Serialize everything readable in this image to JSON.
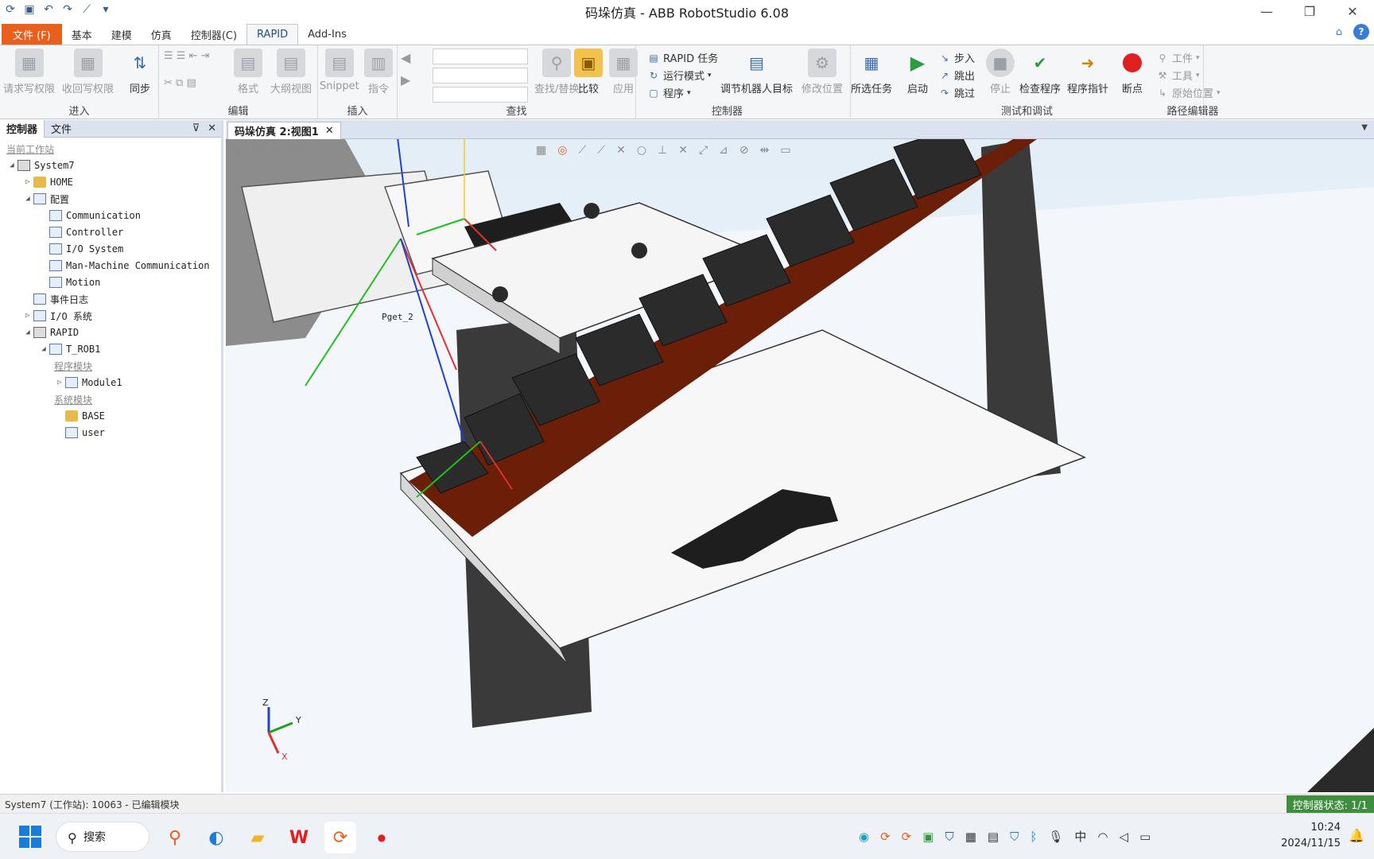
{
  "window": {
    "title": "码垛仿真 - ABB RobotStudio 6.08",
    "minimize": "—",
    "restore": "❐",
    "close": "✕"
  },
  "ribbon_tabs": [
    {
      "label": "文件 (F)"
    },
    {
      "label": "基本"
    },
    {
      "label": "建模"
    },
    {
      "label": "仿真"
    },
    {
      "label": "控制器(C)"
    },
    {
      "label": "RAPID"
    },
    {
      "label": "Add-Ins"
    }
  ],
  "ribbon": {
    "groups": {
      "enter": "进入",
      "edit": "编辑",
      "insert": "插入",
      "find": "查找",
      "controller": "控制器",
      "test": "测试和调试",
      "path_editor": "路径编辑器"
    },
    "buttons": {
      "request_write": "请求写权限",
      "release_write": "收回写权限",
      "sync": "同步",
      "format": "格式",
      "outline": "大纲视图",
      "snippet": "Snippet",
      "instruction": "指令",
      "find_replace": "查找/替换",
      "compare": "比较",
      "apply": "应用",
      "rapid_task": "RAPID 任务",
      "run_mode": "运行模式",
      "program": "程序",
      "adjust_targets": "调节机器人目标",
      "modify_position": "修改位置",
      "selected_tasks": "所选任务",
      "start": "启动",
      "step_in": "步入",
      "step_out": "跳出",
      "step_over": "跳过",
      "stop": "停止",
      "check_program": "检查程序",
      "program_pointer": "程序指针",
      "breakpoint": "断点",
      "workobject": "工件",
      "tool": "工具",
      "home_position": "原始位置"
    }
  },
  "left_panel": {
    "tabs": [
      "控制器",
      "文件"
    ],
    "pin": "⊽",
    "close": "✕",
    "tree": [
      {
        "label": "当前工作站",
        "indent": 0,
        "expander": "",
        "icon": "",
        "link": true
      },
      {
        "label": "System7",
        "indent": 0,
        "expander": "◢",
        "icon": "controller-icon"
      },
      {
        "label": "HOME",
        "indent": 1,
        "expander": "▷",
        "icon": "folder-icon"
      },
      {
        "label": "配置",
        "indent": 1,
        "expander": "◢",
        "icon": "config-icon"
      },
      {
        "label": "Communication",
        "indent": 2,
        "expander": "",
        "icon": "config-topic-icon"
      },
      {
        "label": "Controller",
        "indent": 2,
        "expander": "",
        "icon": "config-topic-icon"
      },
      {
        "label": "I/O System",
        "indent": 2,
        "expander": "",
        "icon": "config-topic-icon"
      },
      {
        "label": "Man-Machine Communication",
        "indent": 2,
        "expander": "",
        "icon": "config-topic-icon"
      },
      {
        "label": "Motion",
        "indent": 2,
        "expander": "",
        "icon": "config-topic-icon"
      },
      {
        "label": "事件日志",
        "indent": 1,
        "expander": "",
        "icon": "event-log-icon"
      },
      {
        "label": "I/O 系统",
        "indent": 1,
        "expander": "▷",
        "icon": "io-system-icon"
      },
      {
        "label": "RAPID",
        "indent": 1,
        "expander": "◢",
        "icon": "rapid-icon"
      },
      {
        "label": "T_ROB1",
        "indent": 2,
        "expander": "◢",
        "icon": "task-icon"
      },
      {
        "label": "程序模块",
        "indent": 3,
        "expander": "",
        "icon": "",
        "link": true
      },
      {
        "label": "Module1",
        "indent": 3,
        "expander": "▷",
        "icon": "module-icon"
      },
      {
        "label": "系统模块",
        "indent": 3,
        "expander": "",
        "icon": "",
        "link": true
      },
      {
        "label": "BASE",
        "indent": 3,
        "expander": "",
        "icon": "lock-module-icon"
      },
      {
        "label": "user",
        "indent": 3,
        "expander": "",
        "icon": "system-module-icon"
      }
    ]
  },
  "document_tab": {
    "label": "码垛仿真 2:视图1",
    "close": "✕"
  },
  "viewport": {
    "target_label": "Pget_2",
    "axis_x": "X",
    "axis_y": "Y",
    "axis_z": "Z",
    "colors": {
      "belt": "#6b1e08",
      "blocks": "#2b2b2b",
      "plate": "#f4f4f4",
      "frame": "#3a3a3a"
    }
  },
  "status": {
    "text": "System7 (工作站): 10063 - 已编辑模块",
    "controller_state": "控制器状态: 1/1"
  },
  "taskbar": {
    "search": "搜索",
    "clock_time": "10:24",
    "clock_date": "2024/11/15",
    "ime": "中"
  }
}
